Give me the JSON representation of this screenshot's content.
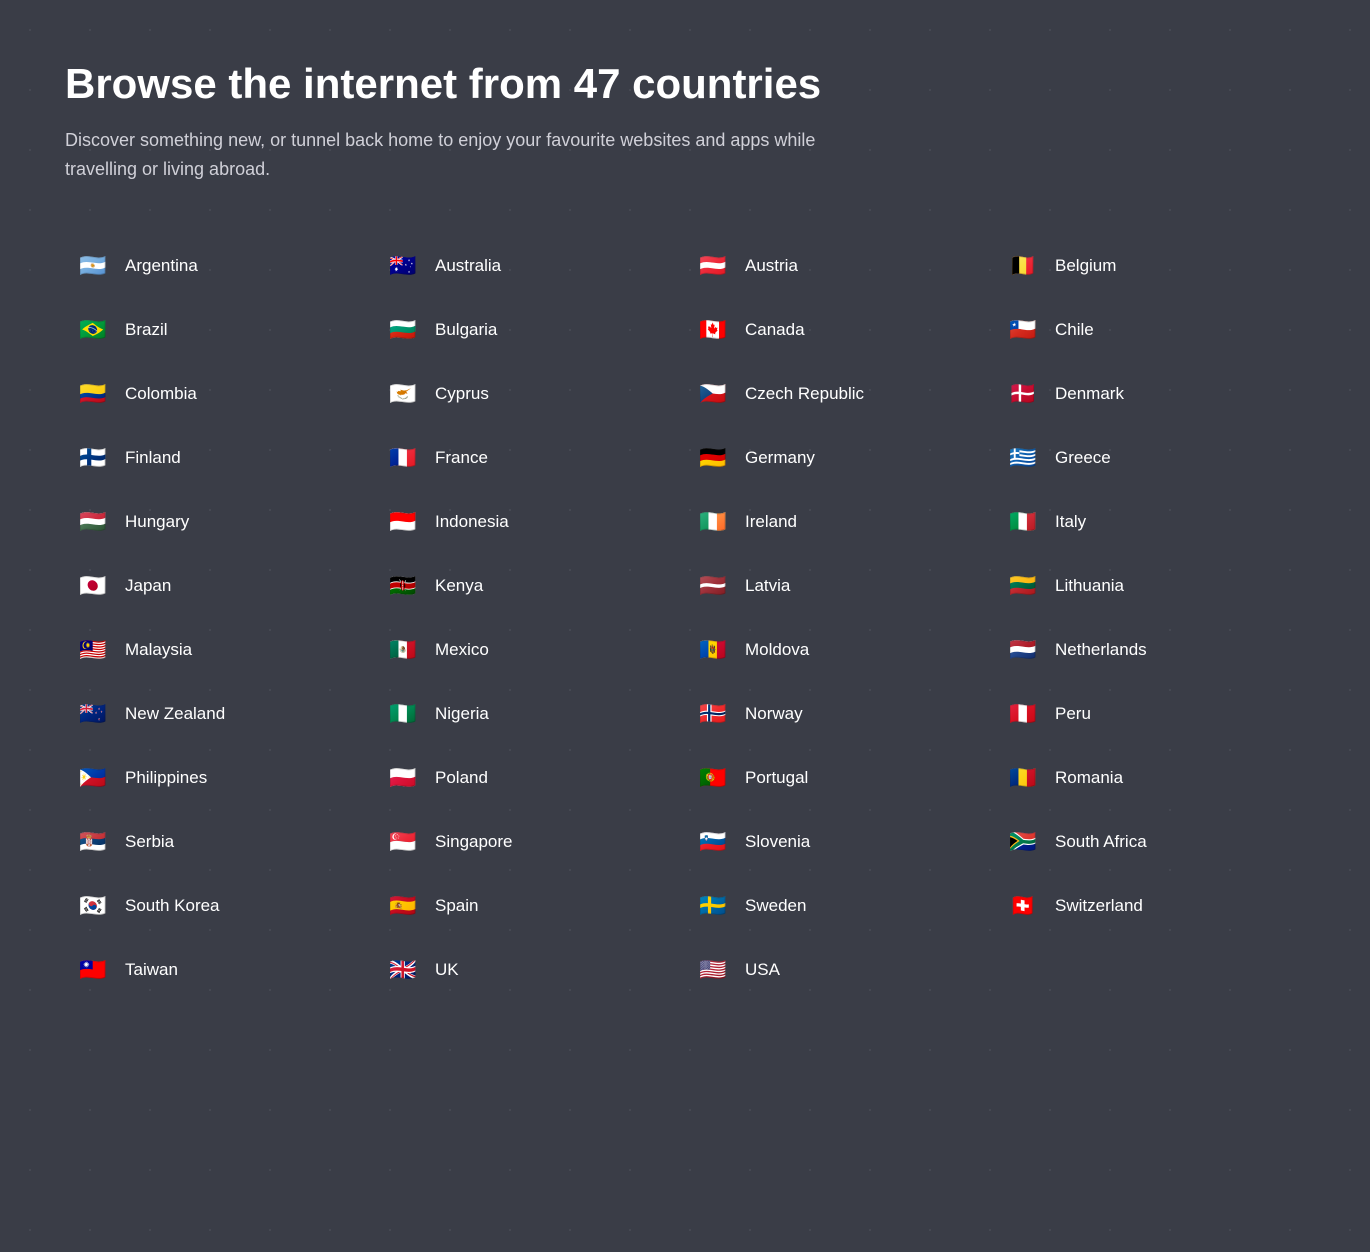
{
  "header": {
    "title": "Browse the internet from 47 countries",
    "subtitle": "Discover something new, or tunnel back home to enjoy your favourite websites and apps while travelling or living abroad."
  },
  "countries": [
    {
      "name": "Argentina",
      "flag": "🇦🇷"
    },
    {
      "name": "Australia",
      "flag": "🇦🇺"
    },
    {
      "name": "Austria",
      "flag": "🇦🇹"
    },
    {
      "name": "Belgium",
      "flag": "🇧🇪"
    },
    {
      "name": "Brazil",
      "flag": "🇧🇷"
    },
    {
      "name": "Bulgaria",
      "flag": "🇧🇬"
    },
    {
      "name": "Canada",
      "flag": "🇨🇦"
    },
    {
      "name": "Chile",
      "flag": "🇨🇱"
    },
    {
      "name": "Colombia",
      "flag": "🇨🇴"
    },
    {
      "name": "Cyprus",
      "flag": "🇨🇾"
    },
    {
      "name": "Czech Republic",
      "flag": "🇨🇿"
    },
    {
      "name": "Denmark",
      "flag": "🇩🇰"
    },
    {
      "name": "Finland",
      "flag": "🇫🇮"
    },
    {
      "name": "France",
      "flag": "🇫🇷"
    },
    {
      "name": "Germany",
      "flag": "🇩🇪"
    },
    {
      "name": "Greece",
      "flag": "🇬🇷"
    },
    {
      "name": "Hungary",
      "flag": "🇭🇺"
    },
    {
      "name": "Indonesia",
      "flag": "🇮🇩"
    },
    {
      "name": "Ireland",
      "flag": "🇮🇪"
    },
    {
      "name": "Italy",
      "flag": "🇮🇹"
    },
    {
      "name": "Japan",
      "flag": "🇯🇵"
    },
    {
      "name": "Kenya",
      "flag": "🇰🇪"
    },
    {
      "name": "Latvia",
      "flag": "🇱🇻"
    },
    {
      "name": "Lithuania",
      "flag": "🇱🇹"
    },
    {
      "name": "Malaysia",
      "flag": "🇲🇾"
    },
    {
      "name": "Mexico",
      "flag": "🇲🇽"
    },
    {
      "name": "Moldova",
      "flag": "🇲🇩"
    },
    {
      "name": "Netherlands",
      "flag": "🇳🇱"
    },
    {
      "name": "New Zealand",
      "flag": "🇳🇿"
    },
    {
      "name": "Nigeria",
      "flag": "🇳🇬"
    },
    {
      "name": "Norway",
      "flag": "🇳🇴"
    },
    {
      "name": "Peru",
      "flag": "🇵🇪"
    },
    {
      "name": "Philippines",
      "flag": "🇵🇭"
    },
    {
      "name": "Poland",
      "flag": "🇵🇱"
    },
    {
      "name": "Portugal",
      "flag": "🇵🇹"
    },
    {
      "name": "Romania",
      "flag": "🇷🇴"
    },
    {
      "name": "Serbia",
      "flag": "🇷🇸"
    },
    {
      "name": "Singapore",
      "flag": "🇸🇬"
    },
    {
      "name": "Slovenia",
      "flag": "🇸🇮"
    },
    {
      "name": "South Africa",
      "flag": "🇿🇦"
    },
    {
      "name": "South Korea",
      "flag": "🇰🇷"
    },
    {
      "name": "Spain",
      "flag": "🇪🇸"
    },
    {
      "name": "Sweden",
      "flag": "🇸🇪"
    },
    {
      "name": "Switzerland",
      "flag": "🇨🇭"
    },
    {
      "name": "Taiwan",
      "flag": "🇹🇼"
    },
    {
      "name": "UK",
      "flag": "🇬🇧"
    },
    {
      "name": "USA",
      "flag": "🇺🇸"
    }
  ]
}
